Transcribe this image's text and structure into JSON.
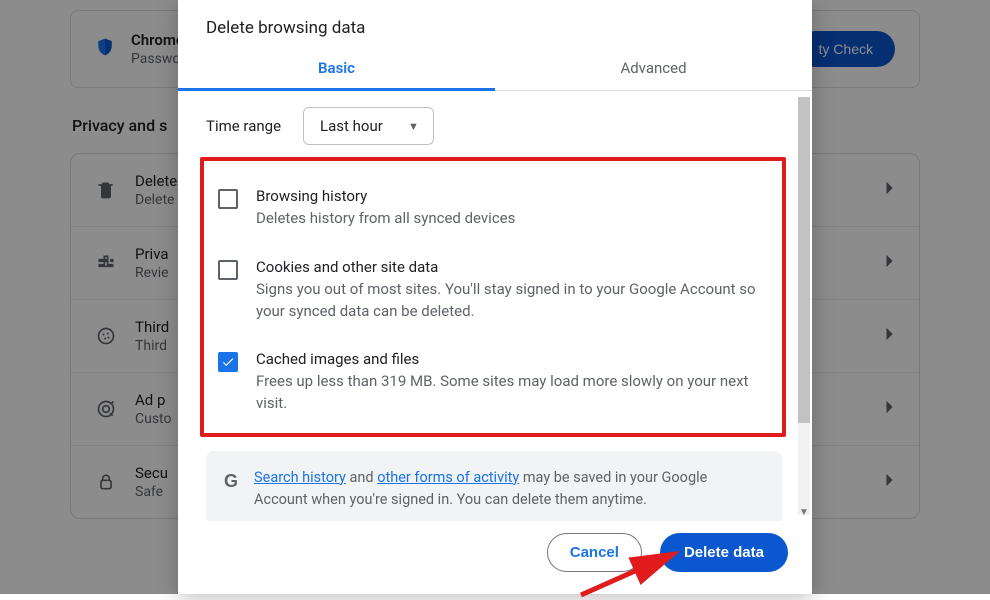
{
  "bg": {
    "top_card": {
      "title": "Chrome",
      "subtitle": "Password",
      "button": "ty Check"
    },
    "section_heading": "Privacy and s",
    "rows": [
      {
        "title": "Delete",
        "subtitle": "Delete"
      },
      {
        "title": "Priva",
        "subtitle": "Revie"
      },
      {
        "title": "Third",
        "subtitle": "Third"
      },
      {
        "title": "Ad p",
        "subtitle": "Custo"
      },
      {
        "title": "Secu",
        "subtitle": "Safe"
      }
    ]
  },
  "dialog": {
    "title": "Delete browsing data",
    "tabs": {
      "basic": "Basic",
      "advanced": "Advanced"
    },
    "time_range": {
      "label": "Time range",
      "selected": "Last hour"
    },
    "options": [
      {
        "key": "history",
        "title": "Browsing history",
        "desc": "Deletes history from all synced devices",
        "checked": false
      },
      {
        "key": "cookies",
        "title": "Cookies and other site data",
        "desc": "Signs you out of most sites. You'll stay signed in to your Google Account so your synced data can be deleted.",
        "checked": false
      },
      {
        "key": "cache",
        "title": "Cached images and files",
        "desc": "Frees up less than 319 MB. Some sites may load more slowly on your next visit.",
        "checked": true
      }
    ],
    "info": {
      "link1": "Search history",
      "mid": " and ",
      "link2": "other forms of activity",
      "rest": " may be saved in your Google Account when you're signed in. You can delete them anytime."
    },
    "buttons": {
      "cancel": "Cancel",
      "confirm": "Delete data"
    }
  }
}
